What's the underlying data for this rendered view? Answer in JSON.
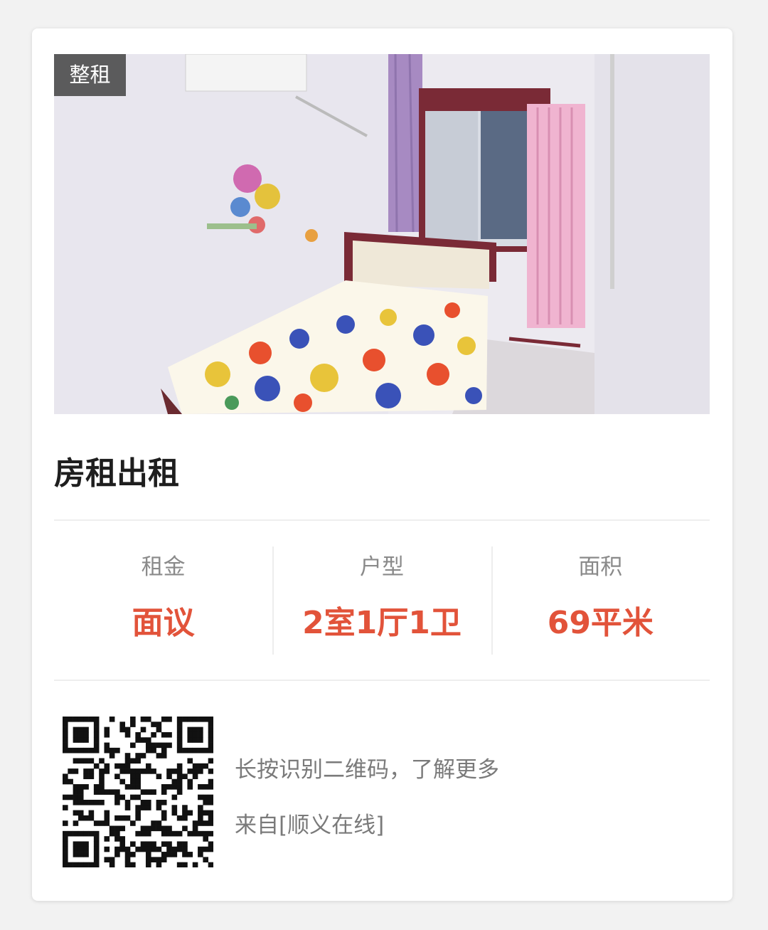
{
  "listing": {
    "tag": "整租",
    "title": "房租出租",
    "photo_alt": "bedroom-photo"
  },
  "stats": [
    {
      "label": "租金",
      "value": "面议"
    },
    {
      "label": "户型",
      "value": "2室1厅1卫"
    },
    {
      "label": "面积",
      "value": "69平米"
    }
  ],
  "footer": {
    "hint": "长按识别二维码，了解更多",
    "source": "来自[顺义在线]"
  },
  "colors": {
    "accent": "#e2533a",
    "label": "#8a8a8a",
    "title": "#1e1e1e",
    "tag_bg": "#3c3c3c"
  },
  "icons": {
    "qr": "qr-code-icon"
  }
}
